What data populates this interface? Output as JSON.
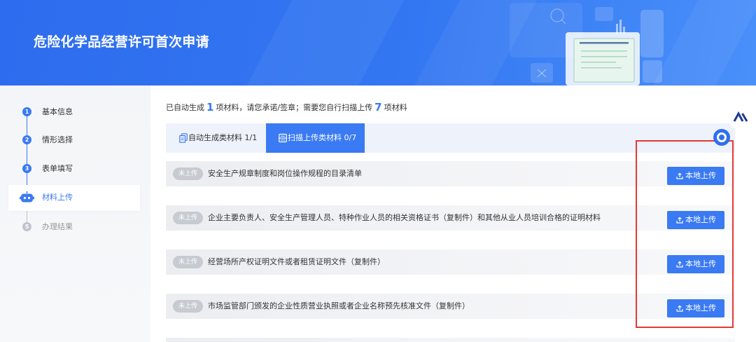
{
  "banner": {
    "title": "危险化学品经营许可首次申请"
  },
  "steps": [
    {
      "num": "1",
      "label": "基本信息",
      "completed": true
    },
    {
      "num": "2",
      "label": "情形选择",
      "completed": true
    },
    {
      "num": "3",
      "label": "表单填写",
      "completed": true
    },
    {
      "icon": "robot-assistant-icon",
      "label": "材料上传",
      "current": true
    },
    {
      "num": "5",
      "label": "办理结果",
      "completed": false
    }
  ],
  "summary": {
    "prefix": "已自动生成",
    "auto_count": "1",
    "middle": "项材料，请您承诺/签章；需要您自行扫描上传",
    "upload_count": "7",
    "suffix": "项材料"
  },
  "tabs": [
    {
      "icon": "copy-document-icon",
      "label": "自动生成类材料 1/1",
      "active": false
    },
    {
      "icon": "scan-icon",
      "label": "扫描上传类材料 0/7",
      "active": true
    }
  ],
  "materials": [
    {
      "status": "未上传",
      "name": "安全生产规章制度和岗位操作规程的目录清单",
      "action": "本地上传"
    },
    {
      "status": "未上传",
      "name": "企业主要负责人、安全生产管理人员、特种作业人员的相关资格证书（复制件）和其他从业人员培训合格的证明材料",
      "action": "本地上传"
    },
    {
      "status": "未上传",
      "name": "经营场所产权证明文件或者租赁证明文件（复制件）",
      "action": "本地上传"
    },
    {
      "status": "未上传",
      "name": "市场监管部门颁发的企业性质营业执照或者企业名称预先核准文件（复制件）",
      "action": "本地上传"
    }
  ],
  "action_icon": "upload-icon",
  "floating": {
    "logo_icon": "brand-logo-icon",
    "assistant_icon": "assistant-ring-icon"
  },
  "colors": {
    "primary": "#3a7af2",
    "banner_start": "#2d6cee",
    "banner_end": "#4a90fa",
    "badge": "#c6cad1",
    "pending": "#c0c4cc",
    "annotation": "#e53935",
    "sidebar_bg": "#f3f5f8"
  }
}
